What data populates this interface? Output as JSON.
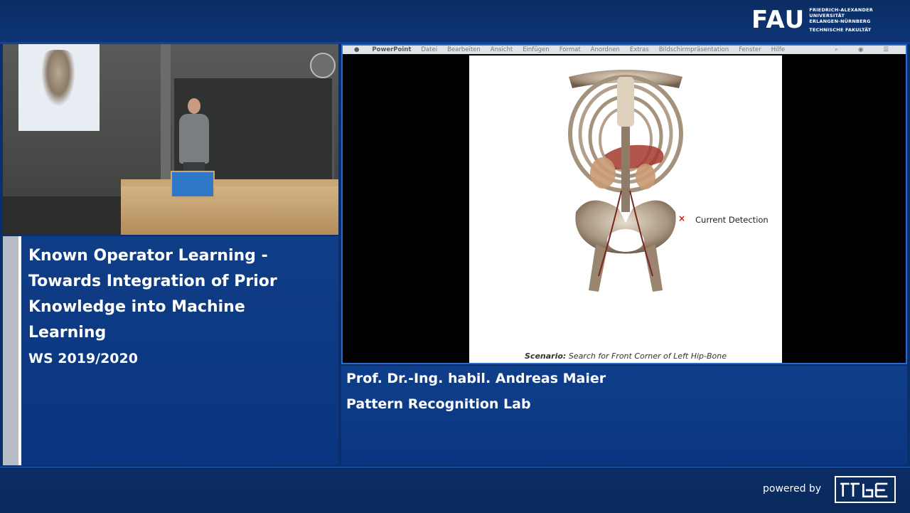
{
  "header": {
    "logo_mark": "FAU",
    "logo_lines": [
      "FRIEDRICH-ALEXANDER",
      "UNIVERSITÄT",
      "ERLANGEN-NÜRNBERG",
      "TECHNISCHE FAKULTÄT"
    ]
  },
  "lecture": {
    "title": "Known Operator Learning - Towards Integration of Prior Knowledge into Machine Learning",
    "semester": "WS 2019/2020"
  },
  "speaker": {
    "name": "Prof. Dr.-Ing. habil. Andreas Maier",
    "lab": "Pattern Recognition Lab"
  },
  "slide": {
    "menubar": {
      "app": "PowerPoint",
      "items": [
        "Datei",
        "Bearbeiten",
        "Ansicht",
        "Einfügen",
        "Format",
        "Anordnen",
        "Extras",
        "Bildschirmpräsentation",
        "Fenster",
        "Hilfe"
      ]
    },
    "detection_label": "Current Detection",
    "detection_mark": "×",
    "scenario_label": "Scenario:",
    "scenario_text": "Search for Front Corner of Left Hip-Bone"
  },
  "footer": {
    "powered_by": "powered by"
  },
  "colors": {
    "panel_blue": "#0f3d86",
    "border_blue": "#2a6bd0",
    "detection_red": "#d11111"
  }
}
